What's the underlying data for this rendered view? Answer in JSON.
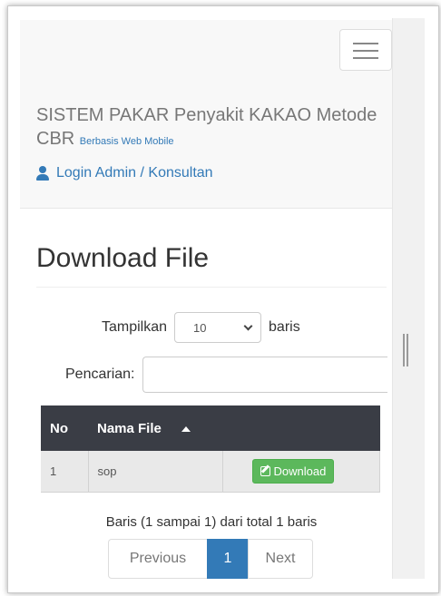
{
  "navbar": {
    "brand_title": "SISTEM PAKAR Penyakit KAKAO Metode CBR",
    "brand_sub": "Berbasis Web Mobile",
    "login_label": "Login Admin / Konsultan"
  },
  "main": {
    "title": "Download File",
    "length_prefix": "Tampilkan",
    "length_value": "10",
    "length_suffix": "baris",
    "search_label": "Pencarian:",
    "table": {
      "headers": [
        "No",
        "Nama File",
        ""
      ],
      "rows": [
        {
          "no": "1",
          "name": "sop",
          "action": "Download"
        }
      ]
    },
    "info": "Baris (1 sampai 1) dari total 1 baris",
    "pagination": {
      "prev": "Previous",
      "current": "1",
      "next": "Next"
    }
  },
  "colors": {
    "header_bg": "#3a3d45",
    "link": "#337ab7",
    "download_btn": "#5cb85c",
    "page_active": "#337ab7"
  },
  "icons": [
    "menu-icon",
    "user-icon",
    "sort-asc-icon",
    "edit-icon",
    "select-chevron-icon"
  ]
}
